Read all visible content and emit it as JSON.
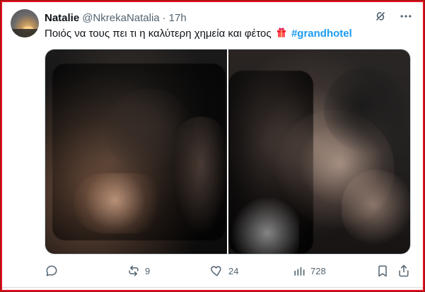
{
  "post": {
    "display_name": "Natalie",
    "handle": "@NkrekaNatalia",
    "separator": "·",
    "time": "17h",
    "text": "Ποιός να τους πει τι η καλύτερη χημεία και φέτος",
    "emoji": "🎁",
    "hashtag": "#grandhotel"
  },
  "actions": {
    "reply_icon": "reply-icon",
    "repost_icon": "repost-icon",
    "repost_count": "9",
    "like_icon": "like-icon",
    "like_count": "24",
    "views_icon": "views-icon",
    "views_count": "728",
    "bookmark_icon": "bookmark-icon",
    "share_icon": "share-icon"
  },
  "colors": {
    "text": "#0f1419",
    "muted": "#536471",
    "hashtag": "#1d9bf0",
    "frame": "#e0141e"
  },
  "top_icons": [
    "grok-icon",
    "more-icon"
  ]
}
